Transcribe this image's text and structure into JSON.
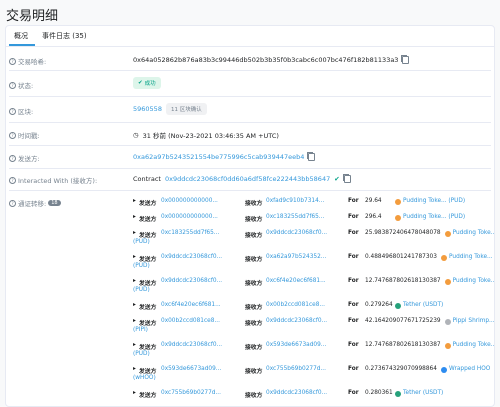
{
  "page_title": "交易明细",
  "tabs": [
    {
      "label": "概况"
    },
    {
      "label": "事件日志 (35)"
    }
  ],
  "fields": {
    "tx_hash": {
      "label": "交易哈希:",
      "value": "0x64a052862b876a83b3c99446db502b3b35f0b3cabc6c007bc476f182b81133a3"
    },
    "status": {
      "label": "状态:",
      "value": "成功"
    },
    "block": {
      "label": "区块:",
      "value": "5960558",
      "confirmations": "11 区块确认"
    },
    "timestamp": {
      "label": "时间戳:",
      "value": "31 秒前 (Nov-23-2021 03:46:35 AM +UTC)"
    },
    "from": {
      "label": "发送方:",
      "value": "0xa62a97b5243521554be775996c5cab939447eeb4"
    },
    "interacted": {
      "label": "Interacted With (接收方):",
      "prefix": "Contract",
      "value": "0x9ddcdc23068cf0dd60a6df58fce222443bb58647"
    },
    "transfers_label": "通证转移:",
    "transfers_count": "18"
  },
  "transfer_words": {
    "from": "发送方",
    "to": "接收方",
    "for": "For"
  },
  "transfers": [
    {
      "from": "0x000000000000...",
      "to": "0xfad9c910b7314...",
      "amount": "29.64",
      "token": "Pudding Toke...",
      "sym": "(PUD)",
      "wrap": false,
      "color": "#f39c3d"
    },
    {
      "from": "0x000000000000...",
      "to": "0xc183255dd7f65...",
      "amount": "296.4",
      "token": "Pudding Toke...",
      "sym": "(PUD)",
      "wrap": false,
      "color": "#f39c3d"
    },
    {
      "from": "0xc183255dd7f65...",
      "to": "0x9ddcdc23068cf0...",
      "amount": "25.983872406478048078",
      "token": "Pudding Toke...",
      "sym": "(PUD)",
      "wrap": true,
      "color": "#f39c3d"
    },
    {
      "from": "0x9ddcdc23068cf0...",
      "to": "0xa62a97b524352...",
      "amount": "0.488496801241787303",
      "token": "Pudding Toke...",
      "sym": "(PUD)",
      "wrap": true,
      "color": "#f39c3d"
    },
    {
      "from": "0x9ddcdc23068cf0...",
      "to": "0xc6f4e20ec6f681...",
      "amount": "12.747687802618130387",
      "token": "Pudding Toke...",
      "sym": "(PUD)",
      "wrap": true,
      "color": "#f39c3d"
    },
    {
      "from": "0xc6f4e20ec6f681...",
      "to": "0x00b2ccd081ce8...",
      "amount": "0.279264",
      "token": "Tether (USDT)",
      "sym": "",
      "wrap": false,
      "color": "#26a17b"
    },
    {
      "from": "0x00b2ccd081ce8...",
      "to": "0x9ddcdc23068cf0...",
      "amount": "42.164209077671725239",
      "token": "Pippi Shrimp...",
      "sym": "(PIPI)",
      "wrap": true,
      "color": "#b0b3b8"
    },
    {
      "from": "0x9ddcdc23068cf0...",
      "to": "0x593de6673ad09...",
      "amount": "12.747687802618130387",
      "token": "Pudding Toke...",
      "sym": "(PUD)",
      "wrap": true,
      "color": "#f39c3d"
    },
    {
      "from": "0x593de6673ad09...",
      "to": "0xc755b69b0277d...",
      "amount": "0.273674329070998864",
      "token": "Wrapped HOO",
      "sym": "(wHOO)",
      "wrap": true,
      "color": "#2d8cf0"
    },
    {
      "from": "0xc755b69b0277d...",
      "to": "0x9ddcdc23068cf0...",
      "amount": "0.280361",
      "token": "Tether (USDT)",
      "sym": "",
      "wrap": false,
      "color": "#26a17b"
    }
  ]
}
